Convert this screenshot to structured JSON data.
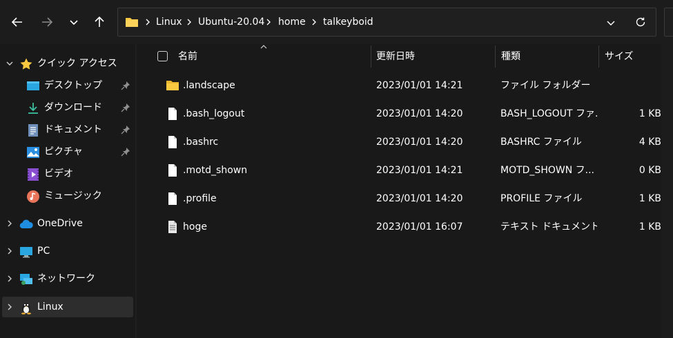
{
  "nav": {
    "back_icon": "arrow-left-icon",
    "forward_icon": "arrow-right-icon",
    "recent_icon": "chevron-down-icon",
    "up_icon": "arrow-up-icon"
  },
  "address": {
    "segments": [
      "Linux",
      "Ubuntu-20.04",
      "home",
      "talkeyboid"
    ]
  },
  "sidebar": {
    "items": [
      {
        "label": "クイック アクセス",
        "icon": "star-icon"
      },
      {
        "label": "デスクトップ",
        "icon": "desktop-icon"
      },
      {
        "label": "ダウンロード",
        "icon": "download-icon"
      },
      {
        "label": "ドキュメント",
        "icon": "document-icon"
      },
      {
        "label": "ピクチャ",
        "icon": "picture-icon"
      },
      {
        "label": "ビデオ",
        "icon": "video-icon"
      },
      {
        "label": "ミュージック",
        "icon": "music-icon"
      },
      {
        "label": "OneDrive",
        "icon": "cloud-icon"
      },
      {
        "label": "PC",
        "icon": "pc-icon"
      },
      {
        "label": "ネットワーク",
        "icon": "network-icon"
      },
      {
        "label": "Linux",
        "icon": "linux-icon"
      }
    ]
  },
  "columns": {
    "name": "名前",
    "date": "更新日時",
    "type": "種類",
    "size": "サイズ"
  },
  "files": [
    {
      "name": ".landscape",
      "date": "2023/01/01 14:21",
      "type": "ファイル フォルダー",
      "size": "",
      "icon": "folder-icon"
    },
    {
      "name": ".bash_logout",
      "date": "2023/01/01 14:20",
      "type": "BASH_LOGOUT ファ...",
      "size": "1 KB",
      "icon": "file-icon"
    },
    {
      "name": ".bashrc",
      "date": "2023/01/01 14:20",
      "type": "BASHRC ファイル",
      "size": "4 KB",
      "icon": "file-icon"
    },
    {
      "name": ".motd_shown",
      "date": "2023/01/01 14:21",
      "type": "MOTD_SHOWN フ...",
      "size": "0 KB",
      "icon": "file-icon"
    },
    {
      "name": ".profile",
      "date": "2023/01/01 14:20",
      "type": "PROFILE ファイル",
      "size": "1 KB",
      "icon": "file-icon"
    },
    {
      "name": "hoge",
      "date": "2023/01/01 16:07",
      "type": "テキスト ドキュメント",
      "size": "1 KB",
      "icon": "text-file-icon"
    }
  ],
  "colors": {
    "background": "#191919",
    "folder": "#f8c940",
    "selected": "#2d2d2d"
  }
}
